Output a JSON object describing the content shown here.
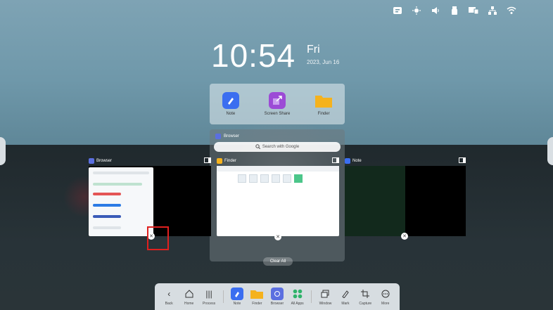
{
  "clock": {
    "time": "10:54",
    "day": "Fri",
    "date": "2023, Jun 16"
  },
  "status_icons": [
    "chat-icon",
    "brightness-icon",
    "volume-icon",
    "usb-icon",
    "screen-icon",
    "network-icon",
    "wifi-icon"
  ],
  "favorites": [
    {
      "label": "Note",
      "icon": "note-icon",
      "color": "#3b6ef0"
    },
    {
      "label": "Screen Share",
      "icon": "screen-share-icon",
      "color": "#9c4bd6"
    },
    {
      "label": "Finder",
      "icon": "folder-icon",
      "color": "#f5b21d"
    }
  ],
  "panel": {
    "title": "Browser",
    "search_placeholder": "Search with Google"
  },
  "cards": [
    {
      "title": "Browser"
    },
    {
      "title": "Finder"
    },
    {
      "title": "Note"
    }
  ],
  "clear_all": "Clear All",
  "dock": [
    {
      "label": "Back",
      "icon": "back-icon"
    },
    {
      "label": "Home",
      "icon": "home-icon"
    },
    {
      "label": "Process",
      "icon": "process-icon"
    },
    {
      "label": "Note",
      "icon": "note-icon"
    },
    {
      "label": "Finder",
      "icon": "folder-icon"
    },
    {
      "label": "Browser",
      "icon": "browser-icon"
    },
    {
      "label": "All Apps",
      "icon": "apps-icon"
    },
    {
      "label": "Window",
      "icon": "window-icon"
    },
    {
      "label": "Mark",
      "icon": "pen-icon"
    },
    {
      "label": "Capture",
      "icon": "crop-icon"
    },
    {
      "label": "More",
      "icon": "more-icon"
    }
  ]
}
